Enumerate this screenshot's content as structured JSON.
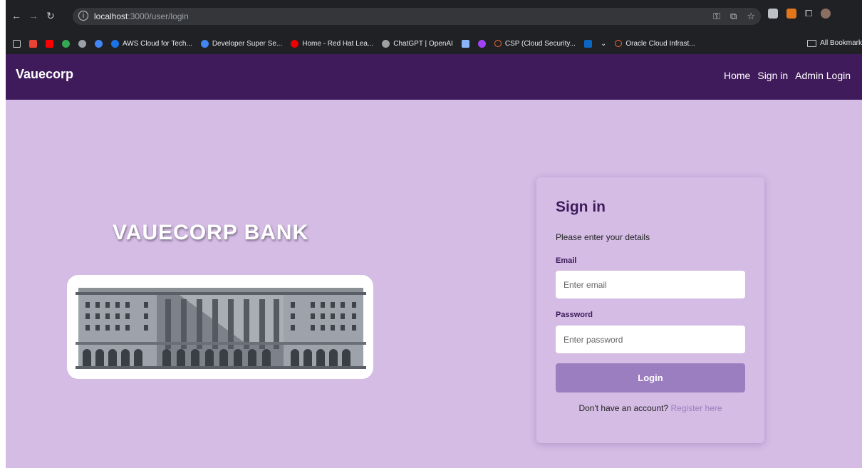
{
  "browser": {
    "url_host": "localhost",
    "url_path": ":3000/user/login",
    "bookmarks": [
      {
        "label": "AWS Cloud for Tech...",
        "color": "#1a73e8"
      },
      {
        "label": "Developer Super Se...",
        "color": "#4285f4"
      },
      {
        "label": "Home - Red Hat Lea...",
        "color": "#ee0000"
      },
      {
        "label": "ChatGPT | OpenAI",
        "color": "#a0a0a0"
      },
      {
        "label": "CSP (Cloud Security...",
        "color": "#f26b2f"
      },
      {
        "label": "Oracle Cloud Infrast...",
        "color": "#f26b2f"
      }
    ],
    "all_bookmarks": "All Bookmark"
  },
  "nav": {
    "brand": "Vauecorp",
    "links": [
      "Home",
      "Sign in",
      "Admin Login"
    ]
  },
  "hero": {
    "title": "VAUECORP BANK"
  },
  "form": {
    "title": "Sign in",
    "subtitle": "Please enter your details",
    "email_label": "Email",
    "email_placeholder": "Enter email",
    "password_label": "Password",
    "password_placeholder": "Enter password",
    "login_label": "Login",
    "register_prompt": "Don't have an account?",
    "register_link": "Register here"
  },
  "colors": {
    "nav_bg": "#3f1b5b",
    "page_bg": "#d4bce5",
    "button": "#9b7ebf"
  }
}
